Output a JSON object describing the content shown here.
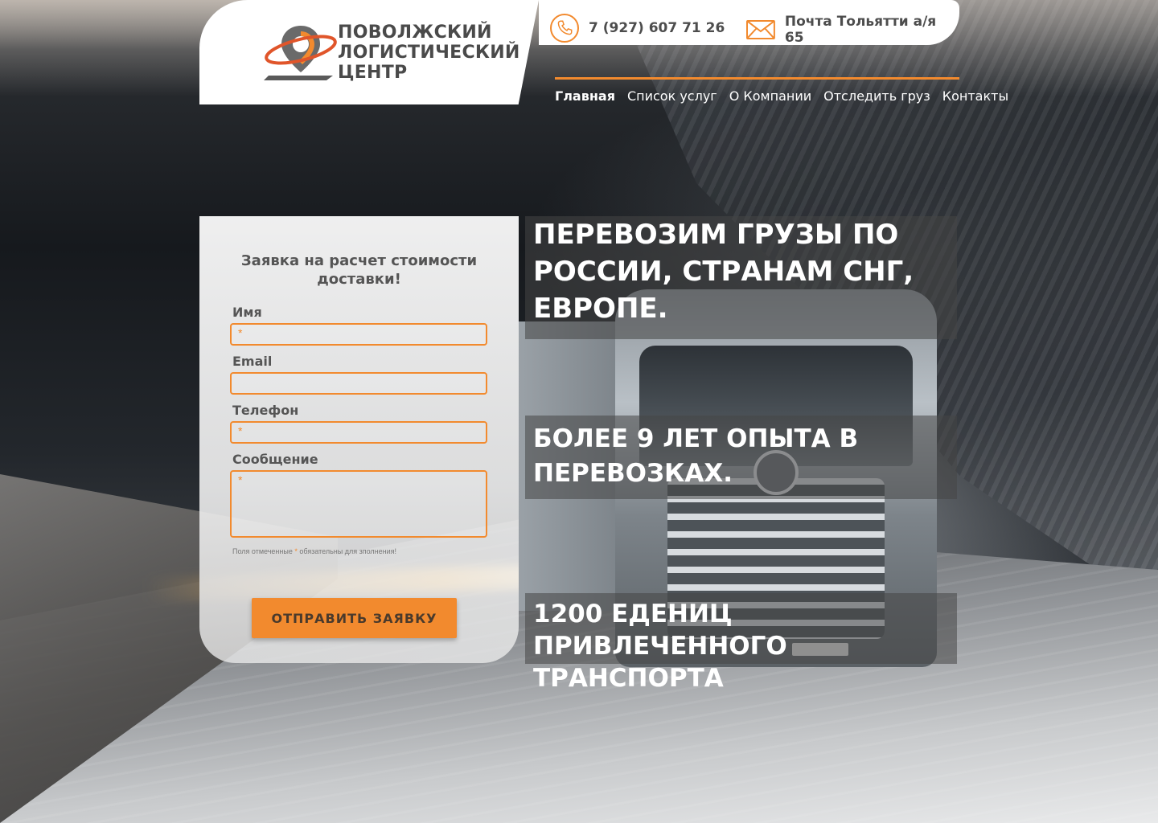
{
  "brand": {
    "line1": "ПОВОЛЖСКИЙ",
    "line2": "ЛОГИСТИЧЕСКИЙ",
    "line3": "ЦЕНТР",
    "accent_color": "#f28a2e"
  },
  "contacts": {
    "phone": "7 (927) 607 71 26",
    "mail": "Почта Тольятти а/я 65"
  },
  "nav": {
    "items": [
      {
        "label": "Главная",
        "active": true
      },
      {
        "label": "Список услуг",
        "active": false
      },
      {
        "label": "О Компании",
        "active": false
      },
      {
        "label": "Отследить груз",
        "active": false
      },
      {
        "label": "Контакты",
        "active": false
      }
    ]
  },
  "form": {
    "title": "Заявка на расчет стоимости доставки!",
    "fields": [
      {
        "label": "Имя",
        "required_mark": "*"
      },
      {
        "label": "Email",
        "required_mark": ""
      },
      {
        "label": "Телефон",
        "required_mark": "*"
      },
      {
        "label": "Сообщение",
        "required_mark": "*"
      }
    ],
    "note_before": "Поля отмеченные ",
    "note_star": "*",
    "note_after": " обязательны для зполнения!",
    "submit_label": "ОТПРАВИТЬ ЗАЯВКУ"
  },
  "hero": {
    "caption1": "Перевозим грузы по России, странам СНГ, Европе.",
    "caption2": "Более 9 лет опыта в перевозках.",
    "caption3": "1200 едениц привлеченного транспорта"
  },
  "icons": {
    "phone": "phone-icon",
    "mail": "envelope-icon",
    "logo": "location-pin-orbit-logo"
  }
}
